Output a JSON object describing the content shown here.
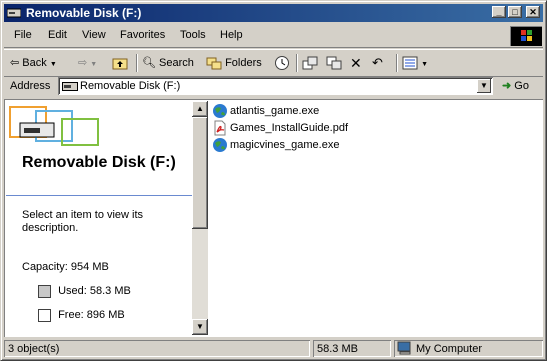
{
  "window": {
    "title": "Removable Disk (F:)"
  },
  "menubar": {
    "items": [
      "File",
      "Edit",
      "View",
      "Favorites",
      "Tools",
      "Help"
    ]
  },
  "toolbar": {
    "back_label": "Back",
    "search_label": "Search",
    "folders_label": "Folders"
  },
  "address": {
    "label": "Address",
    "value": "Removable Disk (F:)",
    "go_label": "Go"
  },
  "leftpane": {
    "title": "Removable Disk (F:)",
    "hint": "Select an item to view its description.",
    "capacity": "Capacity: 954 MB",
    "used": "Used: 58.3 MB",
    "free": "Free: 896 MB"
  },
  "files": [
    {
      "name": "atlantis_game.exe",
      "icon": "exe-globe-icon"
    },
    {
      "name": "Games_InstallGuide.pdf",
      "icon": "pdf-icon"
    },
    {
      "name": "magicvines_game.exe",
      "icon": "exe-globe-icon"
    }
  ],
  "status": {
    "objects": "3 object(s)",
    "size": "58.3 MB",
    "location": "My Computer"
  },
  "colors": {
    "titlebar_start": "#0a246a",
    "titlebar_end": "#3a6ea5",
    "chrome": "#d4d0c8"
  }
}
